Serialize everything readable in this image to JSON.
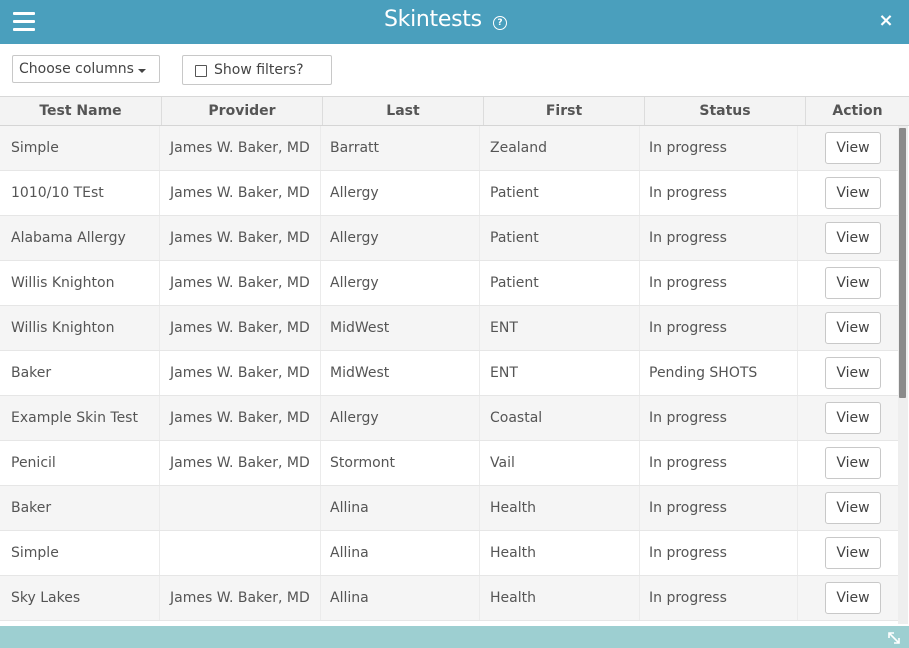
{
  "window": {
    "title": "Skintests",
    "help_icon": "?",
    "close_icon": "×"
  },
  "toolbar": {
    "choose_columns_label": "Choose columns",
    "show_filters_label": "Show filters?",
    "show_filters_checked": false
  },
  "grid": {
    "columns": [
      "Test Name",
      "Provider",
      "Last",
      "First",
      "Status",
      "Action"
    ],
    "rows": [
      {
        "test_name": "Simple",
        "provider": "James W. Baker, MD",
        "last": "Barratt",
        "first": "Zealand",
        "status": "In progress",
        "action": "View"
      },
      {
        "test_name": "1010/10 TEst",
        "provider": "James W. Baker, MD",
        "last": "Allergy",
        "first": "Patient",
        "status": "In progress",
        "action": "View"
      },
      {
        "test_name": "Alabama Allergy",
        "provider": "James W. Baker, MD",
        "last": "Allergy",
        "first": "Patient",
        "status": "In progress",
        "action": "View"
      },
      {
        "test_name": "Willis Knighton",
        "provider": "James W. Baker, MD",
        "last": "Allergy",
        "first": "Patient",
        "status": "In progress",
        "action": "View"
      },
      {
        "test_name": "Willis Knighton",
        "provider": "James W. Baker, MD",
        "last": "MidWest",
        "first": "ENT",
        "status": "In progress",
        "action": "View"
      },
      {
        "test_name": "Baker",
        "provider": "James W. Baker, MD",
        "last": "MidWest",
        "first": "ENT",
        "status": "Pending SHOTS",
        "action": "View"
      },
      {
        "test_name": "Example Skin Test",
        "provider": "James W. Baker, MD",
        "last": "Allergy",
        "first": "Coastal",
        "status": "In progress",
        "action": "View"
      },
      {
        "test_name": "Penicil",
        "provider": "James W. Baker, MD",
        "last": "Stormont",
        "first": "Vail",
        "status": "In progress",
        "action": "View"
      },
      {
        "test_name": "Baker",
        "provider": "",
        "last": "Allina",
        "first": "Health",
        "status": "In progress",
        "action": "View"
      },
      {
        "test_name": "Simple",
        "provider": "",
        "last": "Allina",
        "first": "Health",
        "status": "In progress",
        "action": "View"
      },
      {
        "test_name": "Sky Lakes",
        "provider": "James W. Baker, MD",
        "last": "Allina",
        "first": "Health",
        "status": "In progress",
        "action": "View"
      }
    ]
  },
  "colors": {
    "titlebar": "#4a9fbd",
    "bottombar": "#9dcfd1",
    "row_alt": "#f5f5f5",
    "header_bg": "#f3f3f3"
  },
  "icons": {
    "menu": "hamburger-menu-icon",
    "help": "question-circle-icon",
    "close": "close-icon",
    "dropdown": "caret-down-icon",
    "resize": "resize-corner-icon"
  }
}
